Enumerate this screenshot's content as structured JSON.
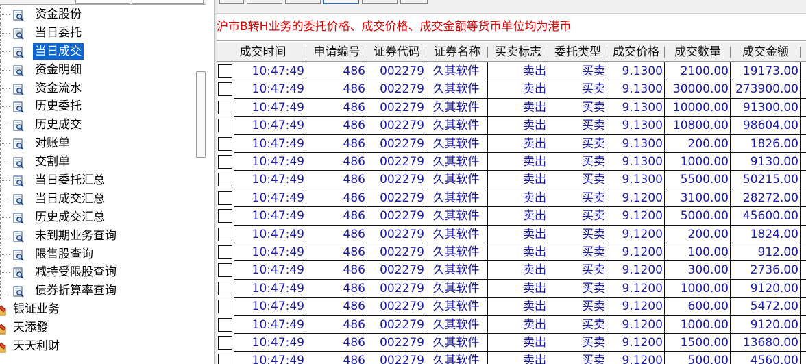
{
  "tree": {
    "items": [
      {
        "label": "资金股份",
        "icon": "search-doc-icon",
        "selected": false
      },
      {
        "label": "当日委托",
        "icon": "search-doc-icon",
        "selected": false
      },
      {
        "label": "当日成交",
        "icon": "search-doc-icon",
        "selected": true
      },
      {
        "label": "资金明细",
        "icon": "search-doc-icon",
        "selected": false
      },
      {
        "label": "资金流水",
        "icon": "search-doc-icon",
        "selected": false
      },
      {
        "label": "历史委托",
        "icon": "search-doc-icon",
        "selected": false
      },
      {
        "label": "历史成交",
        "icon": "search-doc-icon",
        "selected": false
      },
      {
        "label": "对账单",
        "icon": "search-doc-icon",
        "selected": false
      },
      {
        "label": "交割单",
        "icon": "search-doc-icon",
        "selected": false
      },
      {
        "label": "当日委托汇总",
        "icon": "search-doc-icon",
        "selected": false
      },
      {
        "label": "当日成交汇总",
        "icon": "search-doc-icon",
        "selected": false
      },
      {
        "label": "历史成交汇总",
        "icon": "search-doc-icon",
        "selected": false
      },
      {
        "label": "未到期业务查询",
        "icon": "search-doc-icon",
        "selected": false
      },
      {
        "label": "限售股查询",
        "icon": "search-doc-icon",
        "selected": false
      },
      {
        "label": "减持受限股查询",
        "icon": "search-doc-icon",
        "selected": false
      },
      {
        "label": "债券折算率查询",
        "icon": "search-doc-icon",
        "selected": false
      }
    ],
    "roots": [
      {
        "label": "银证业务",
        "icon": "folder-pen-icon"
      },
      {
        "label": "天添發",
        "icon": "folder-pen-icon"
      },
      {
        "label": "天天利财",
        "icon": "folder-pen-icon"
      }
    ]
  },
  "notice": "沪市B转H业务的委托价格、成交价格、成交金额等货币单位均为港币",
  "table": {
    "columns": [
      "成交时间",
      "申请编号",
      "证券代码",
      "证券名称",
      "买卖标志",
      "委托类型",
      "成交价格",
      "成交数量",
      "成交金额",
      "成"
    ],
    "rows": [
      [
        "10:47:49",
        "486",
        "002279",
        "久其软件",
        "卖出",
        "买卖",
        "9.1300",
        "2100.00",
        "19173.00"
      ],
      [
        "10:47:49",
        "486",
        "002279",
        "久其软件",
        "卖出",
        "买卖",
        "9.1300",
        "30000.00",
        "273900.00"
      ],
      [
        "10:47:49",
        "486",
        "002279",
        "久其软件",
        "卖出",
        "买卖",
        "9.1300",
        "10000.00",
        "91300.00"
      ],
      [
        "10:47:49",
        "486",
        "002279",
        "久其软件",
        "卖出",
        "买卖",
        "9.1300",
        "10800.00",
        "98604.00"
      ],
      [
        "10:47:49",
        "486",
        "002279",
        "久其软件",
        "卖出",
        "买卖",
        "9.1300",
        "200.00",
        "1826.00"
      ],
      [
        "10:47:49",
        "486",
        "002279",
        "久其软件",
        "卖出",
        "买卖",
        "9.1300",
        "1000.00",
        "9130.00"
      ],
      [
        "10:47:49",
        "486",
        "002279",
        "久其软件",
        "卖出",
        "买卖",
        "9.1300",
        "5500.00",
        "50215.00"
      ],
      [
        "10:47:49",
        "486",
        "002279",
        "久其软件",
        "卖出",
        "买卖",
        "9.1200",
        "3100.00",
        "28272.00"
      ],
      [
        "10:47:49",
        "486",
        "002279",
        "久其软件",
        "卖出",
        "买卖",
        "9.1200",
        "5000.00",
        "45600.00"
      ],
      [
        "10:47:49",
        "486",
        "002279",
        "久其软件",
        "卖出",
        "买卖",
        "9.1200",
        "200.00",
        "1824.00"
      ],
      [
        "10:47:49",
        "486",
        "002279",
        "久其软件",
        "卖出",
        "买卖",
        "9.1200",
        "100.00",
        "912.00"
      ],
      [
        "10:47:49",
        "486",
        "002279",
        "久其软件",
        "卖出",
        "买卖",
        "9.1200",
        "300.00",
        "2736.00"
      ],
      [
        "10:47:49",
        "486",
        "002279",
        "久其软件",
        "卖出",
        "买卖",
        "9.1200",
        "1000.00",
        "9120.00"
      ],
      [
        "10:47:49",
        "486",
        "002279",
        "久其软件",
        "卖出",
        "买卖",
        "9.1200",
        "600.00",
        "5472.00"
      ],
      [
        "10:47:49",
        "486",
        "002279",
        "久其软件",
        "卖出",
        "买卖",
        "9.1200",
        "1000.00",
        "9120.00"
      ],
      [
        "10:47:49",
        "486",
        "002279",
        "久其软件",
        "卖出",
        "买卖",
        "9.1200",
        "1500.00",
        "13680.00"
      ],
      [
        "10:47:49",
        "486",
        "002279",
        "久其软件",
        "卖出",
        "买卖",
        "9.1200",
        "500.00",
        "4560.00"
      ]
    ]
  },
  "colors": {
    "selected_bg": "#0a64d2",
    "notice_text": "#e00000",
    "cell_text": "#1a1aa6"
  }
}
